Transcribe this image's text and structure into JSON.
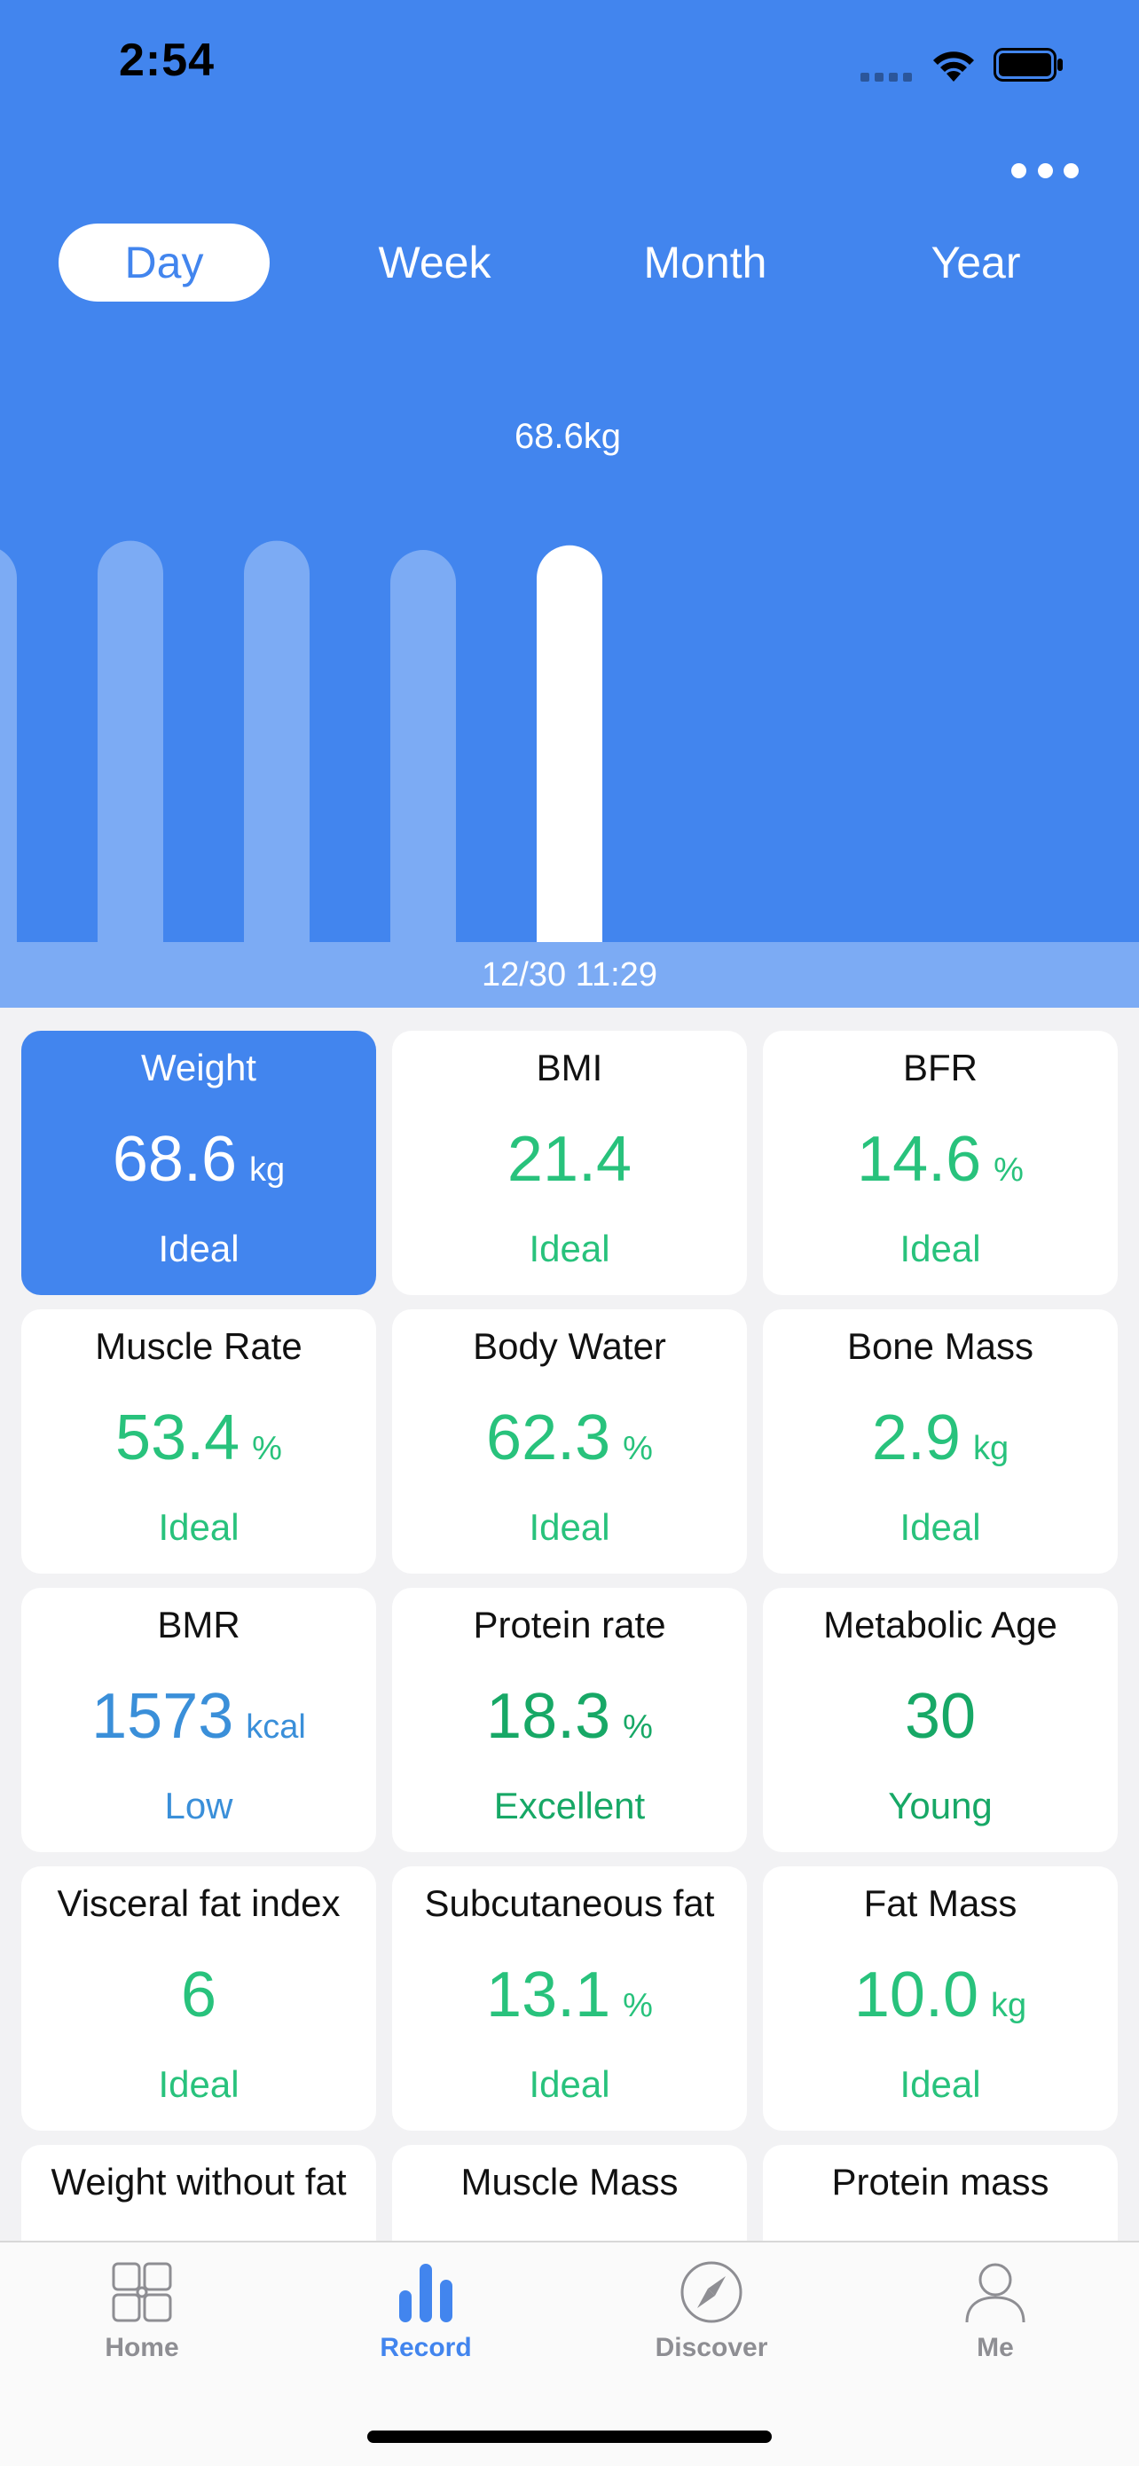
{
  "status_bar": {
    "time": "2:54"
  },
  "header": {
    "background_color": "#4285ee",
    "period_tabs": [
      {
        "label": "Day",
        "active": true
      },
      {
        "label": "Week",
        "active": false
      },
      {
        "label": "Month",
        "active": false
      },
      {
        "label": "Year",
        "active": false
      }
    ],
    "more_icon": "ellipsis-icon"
  },
  "chart_data": {
    "type": "bar",
    "selected_label": "68.6kg",
    "selected_date": "12/30 11:29",
    "values_kg": [
      68.6,
      68.7,
      68.7,
      68.5,
      68.6
    ],
    "selected_index": 4,
    "bar_color": "#ffffff",
    "bar_faded_color": "#7cabf4"
  },
  "metrics": [
    {
      "label": "Weight",
      "value": "68.6",
      "unit": "kg",
      "status": "Ideal",
      "selected": true,
      "tone": "ideal"
    },
    {
      "label": "BMI",
      "value": "21.4",
      "unit": "",
      "status": "Ideal",
      "selected": false,
      "tone": "ideal"
    },
    {
      "label": "BFR",
      "value": "14.6",
      "unit": "%",
      "status": "Ideal",
      "selected": false,
      "tone": "ideal"
    },
    {
      "label": "Muscle Rate",
      "value": "53.4",
      "unit": "%",
      "status": "Ideal",
      "selected": false,
      "tone": "ideal"
    },
    {
      "label": "Body Water",
      "value": "62.3",
      "unit": "%",
      "status": "Ideal",
      "selected": false,
      "tone": "ideal"
    },
    {
      "label": "Bone Mass",
      "value": "2.9",
      "unit": "kg",
      "status": "Ideal",
      "selected": false,
      "tone": "ideal"
    },
    {
      "label": "BMR",
      "value": "1573",
      "unit": "kcal",
      "status": "Low",
      "selected": false,
      "tone": "low"
    },
    {
      "label": "Protein rate",
      "value": "18.3",
      "unit": "%",
      "status": "Excellent",
      "selected": false,
      "tone": "excellent"
    },
    {
      "label": "Metabolic Age",
      "value": "30",
      "unit": "",
      "status": "Young",
      "selected": false,
      "tone": "young"
    },
    {
      "label": "Visceral fat index",
      "value": "6",
      "unit": "",
      "status": "Ideal",
      "selected": false,
      "tone": "ideal"
    },
    {
      "label": "Subcutaneous fat",
      "value": "13.1",
      "unit": "%",
      "status": "Ideal",
      "selected": false,
      "tone": "ideal"
    },
    {
      "label": "Fat Mass",
      "value": "10.0",
      "unit": "kg",
      "status": "Ideal",
      "selected": false,
      "tone": "ideal"
    },
    {
      "label": "Weight without fat",
      "value": "",
      "unit": "",
      "status": "",
      "selected": false,
      "tone": "ideal"
    },
    {
      "label": "Muscle Mass",
      "value": "",
      "unit": "",
      "status": "",
      "selected": false,
      "tone": "ideal"
    },
    {
      "label": "Protein mass",
      "value": "",
      "unit": "",
      "status": "",
      "selected": false,
      "tone": "ideal"
    }
  ],
  "colors": {
    "ideal": "#28c27c",
    "excellent": "#17a866",
    "low": "#3a8fd9",
    "accent": "#4285ee"
  },
  "tabbar": {
    "items": [
      {
        "label": "Home",
        "icon": "grid-icon",
        "active": false
      },
      {
        "label": "Record",
        "icon": "bar-chart-icon",
        "active": true
      },
      {
        "label": "Discover",
        "icon": "compass-icon",
        "active": false
      },
      {
        "label": "Me",
        "icon": "person-icon",
        "active": false
      }
    ]
  }
}
